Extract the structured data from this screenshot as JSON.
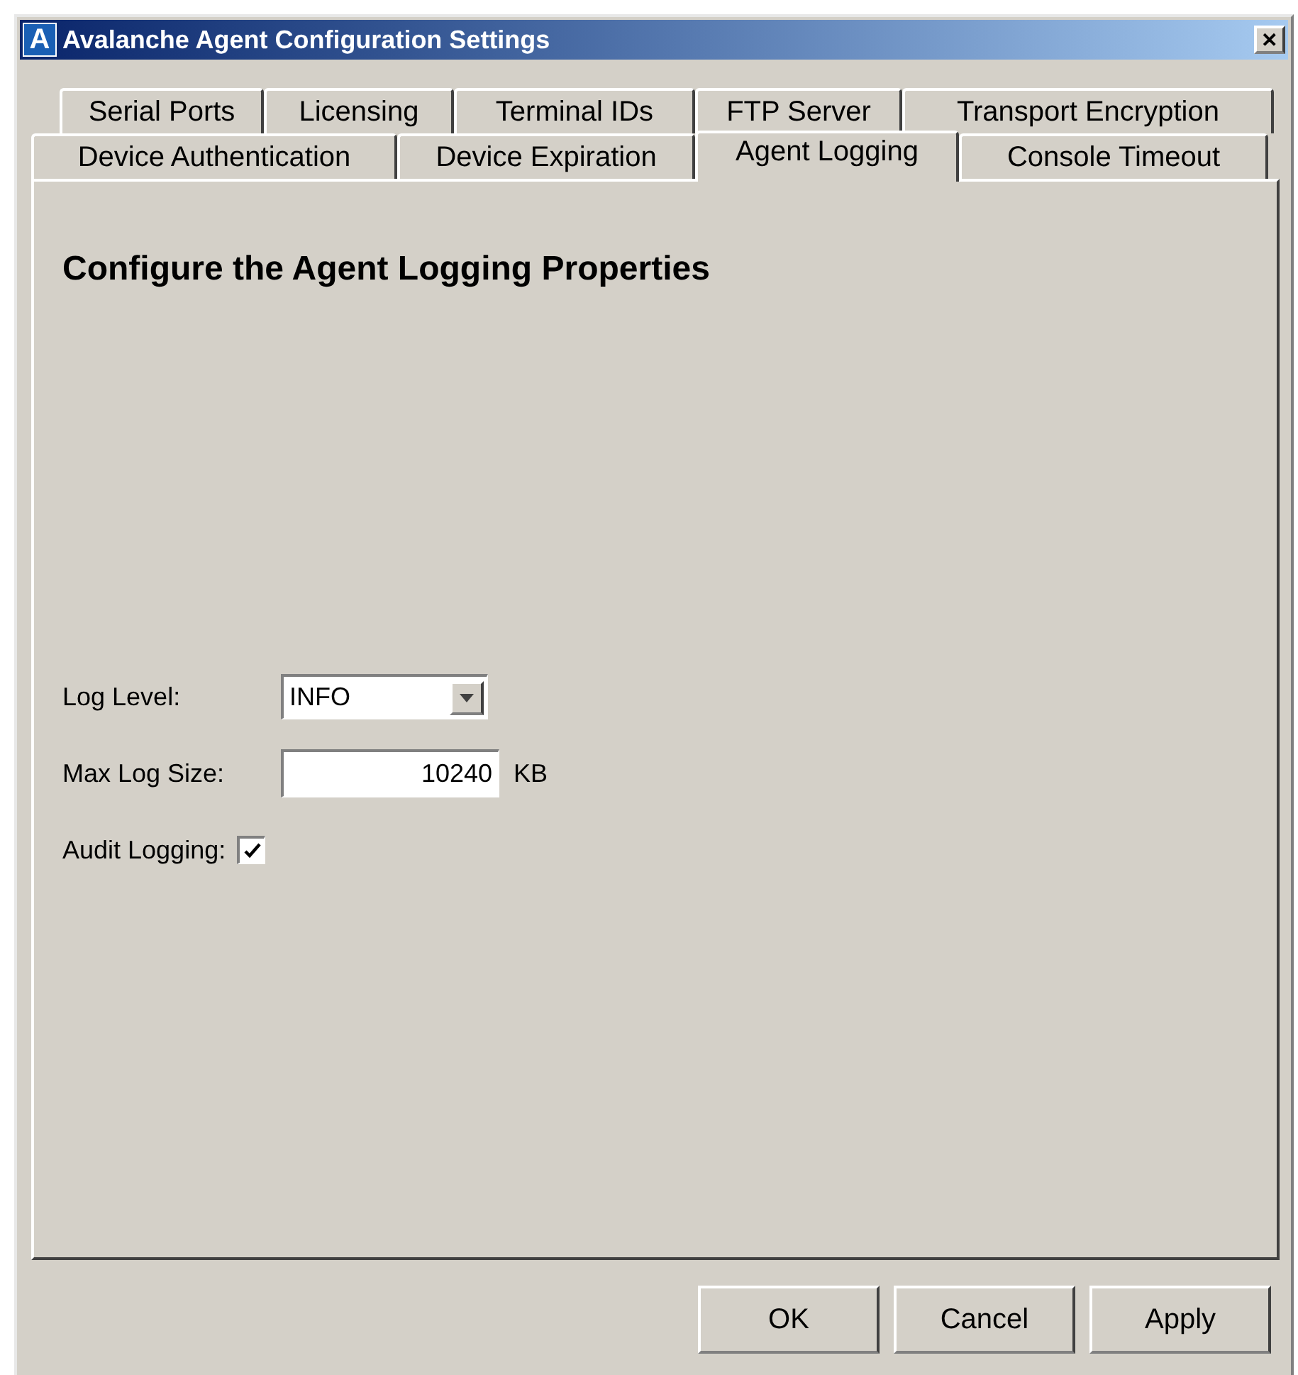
{
  "window": {
    "logo": "A",
    "title": "Avalanche Agent Configuration Settings",
    "close": "✕"
  },
  "tab_rows": [
    [
      {
        "label": "Serial Ports",
        "selected": false
      },
      {
        "label": "Licensing",
        "selected": false
      },
      {
        "label": "Terminal IDs",
        "selected": false
      },
      {
        "label": "FTP Server",
        "selected": false
      },
      {
        "label": "Transport Encryption",
        "selected": false
      }
    ],
    [
      {
        "label": "Device Authentication",
        "selected": false
      },
      {
        "label": "Device Expiration",
        "selected": false
      },
      {
        "label": "Agent Logging",
        "selected": true
      },
      {
        "label": "Console Timeout",
        "selected": false
      }
    ]
  ],
  "heading": "Configure the Agent Logging Properties",
  "fields": [
    {
      "kind": "dropdown",
      "label": "Log Level:",
      "value": "INFO"
    },
    {
      "kind": "number",
      "label": "Max Log Size:",
      "value": "10240",
      "unit": "KB"
    },
    {
      "kind": "checkbox",
      "label": "Audit Logging:",
      "checked": true
    }
  ],
  "buttons": [
    "OK",
    "Cancel",
    "Apply"
  ]
}
